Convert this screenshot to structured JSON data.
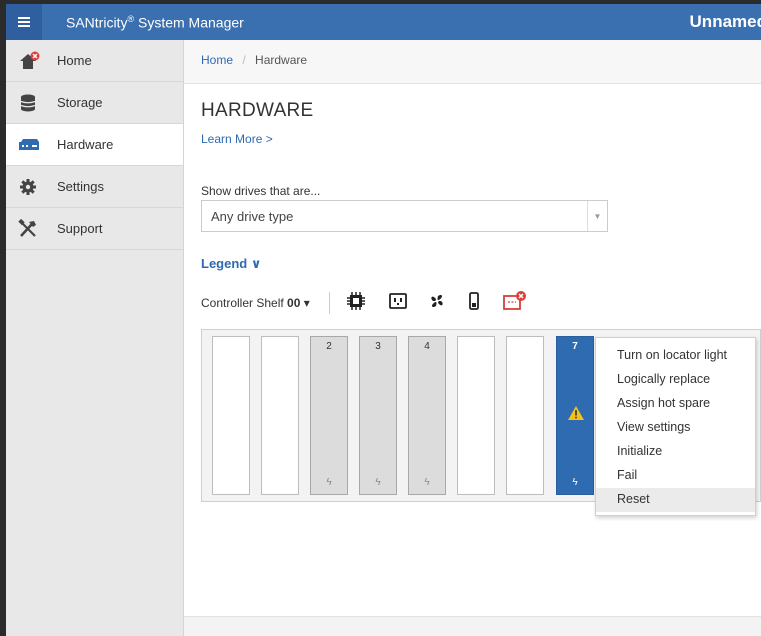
{
  "header": {
    "menu_icon": "hamburger-icon",
    "app_name": "SANtricity",
    "app_reg": "®",
    "app_suffix": " System Manager",
    "system_name": "Unnamed",
    "bar_color": "#3a6fb0"
  },
  "sidebar": {
    "items": [
      {
        "label": "Home",
        "icon": "home-icon",
        "active": false
      },
      {
        "label": "Storage",
        "icon": "storage-icon",
        "active": false
      },
      {
        "label": "Hardware",
        "icon": "hardware-icon",
        "active": true
      },
      {
        "label": "Settings",
        "icon": "gear-icon",
        "active": false
      },
      {
        "label": "Support",
        "icon": "tools-icon",
        "active": false
      }
    ]
  },
  "breadcrumb": {
    "home": "Home",
    "separator": "/",
    "current": "Hardware"
  },
  "page": {
    "title": "HARDWARE",
    "learn_more": "Learn More >",
    "filter_label": "Show drives that are...",
    "filter_value": "Any drive type",
    "filter_caret": "▼",
    "legend": "Legend ∨"
  },
  "shelf": {
    "label": "Controller Shelf ",
    "number": "00",
    "caret": " ▾",
    "icons": [
      "controller-chip-icon",
      "power-supply-icon",
      "fan-icon",
      "battery-icon",
      "alert-shelf-icon"
    ]
  },
  "drives": {
    "slots": [
      {
        "number": "",
        "state": "empty"
      },
      {
        "number": "",
        "state": "empty"
      },
      {
        "number": "2",
        "state": "filled"
      },
      {
        "number": "3",
        "state": "filled"
      },
      {
        "number": "4",
        "state": "filled"
      },
      {
        "number": "",
        "state": "empty"
      },
      {
        "number": "",
        "state": "empty"
      },
      {
        "number": "7",
        "state": "selected",
        "warning": true
      }
    ],
    "bolt_glyph": "ϟ",
    "selected_color": "#2f6bb0"
  },
  "context_menu": {
    "items": [
      {
        "label": "Turn on locator light",
        "hover": false
      },
      {
        "label": "Logically replace",
        "hover": false
      },
      {
        "label": "Assign hot spare",
        "hover": false
      },
      {
        "label": "View settings",
        "hover": false
      },
      {
        "label": "Initialize",
        "hover": false
      },
      {
        "label": "Fail",
        "hover": false
      },
      {
        "label": "Reset",
        "hover": true
      }
    ]
  }
}
